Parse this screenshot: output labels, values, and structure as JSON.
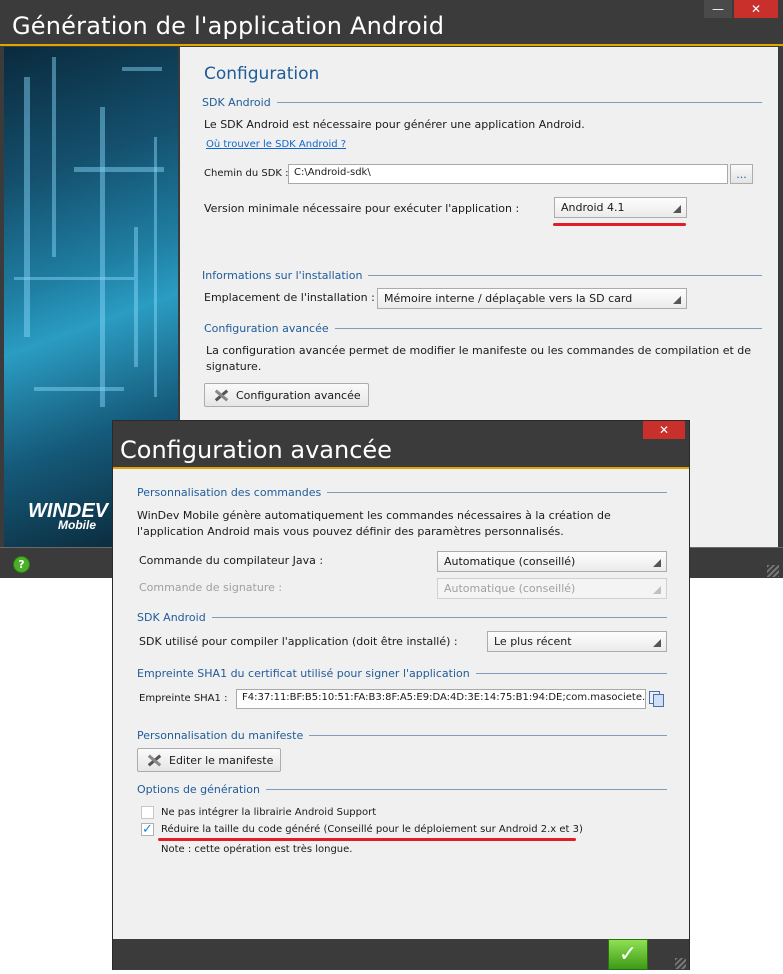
{
  "back_window": {
    "title": "Génération de l'application Android",
    "min_glyph": "—",
    "close_glyph": "✕",
    "logo_main": "WINDEV",
    "logo_sub": "Mobile",
    "heading": "Configuration",
    "sdk_section": "SDK Android",
    "sdk_desc": "Le SDK Android est nécessaire pour générer une application Android.",
    "sdk_link": "Où trouver le SDK Android ?",
    "sdk_path_label": "Chemin du SDK :",
    "sdk_path_value": "C:\\Android-sdk\\",
    "browse_label": "...",
    "min_version_label": "Version minimale nécessaire pour exécuter l'application :",
    "min_version_value": "Android 4.1",
    "install_section": "Informations sur l'installation",
    "install_location_label": "Emplacement de l'installation :",
    "install_location_value": "Mémoire interne / déplaçable vers la SD card",
    "advanced_section": "Configuration avancée",
    "advanced_desc": "La configuration avancée permet de modifier le manifeste ou les commandes de compilation et de signature.",
    "advanced_button": "Configuration avancée",
    "help_glyph": "?"
  },
  "dialog": {
    "title": "Configuration avancée",
    "close_glyph": "✕",
    "commands_section": "Personnalisation des commandes",
    "commands_desc": "WinDev Mobile génère automatiquement les commandes nécessaires à la création de l'application Android mais vous pouvez définir des paramètres personnalisés.",
    "java_label": "Commande du compilateur Java :",
    "java_value": "Automatique (conseillé)",
    "sign_label": "Commande de signature :",
    "sign_value": "Automatique (conseillé)",
    "sdk_section": "SDK Android",
    "sdk_label": "SDK utilisé pour compiler l'application (doit être installé) :",
    "sdk_value": "Le plus récent",
    "sha_section": "Empreinte SHA1 du certificat utilisé pour signer l'application",
    "sha_label": "Empreinte SHA1 :",
    "sha_value": "F4:37:11:BF:B5:10:51:FA:B3:8F:A5:E9:DA:4D:3E:14:75:B1:94:DE;com.masociete.",
    "manifest_section": "Personnalisation du manifeste",
    "manifest_button": "Editer le manifeste",
    "options_section": "Options de génération",
    "opt1_label": "Ne pas intégrer la librairie Android Support",
    "opt2_label": "Réduire la taille du code généré (Conseillé pour le déploiement sur Android 2.x et 3)",
    "opt2_check_glyph": "✓",
    "note": "Note : cette opération est très longue.",
    "ok_glyph": "✓"
  },
  "colors": {
    "accent": "#e2a400",
    "heading_blue": "#1f5c99",
    "highlight_red": "#e11d2a",
    "close_red": "#c9302c",
    "ok_green": "#4caf2a"
  },
  "icons": [
    "help-icon",
    "close-icon",
    "minimize-icon",
    "tools-icon",
    "copy-icon",
    "check-icon"
  ]
}
